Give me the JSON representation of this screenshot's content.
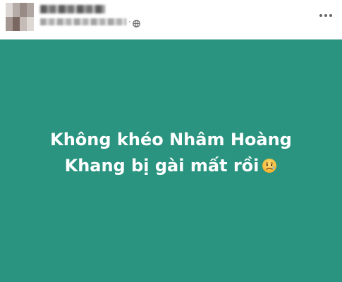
{
  "post": {
    "author_name": "",
    "meta_separator": "·",
    "privacy_icon": "globe-icon",
    "more_icon": "more-horizontal-icon"
  },
  "status": {
    "background_color": "#2a9480",
    "text_color": "#ffffff",
    "lines": [
      "Không khéo Nhâm Hoàng",
      "Khang bị gài mất rồi"
    ],
    "emoji": "sad-but-relieved-face-icon"
  }
}
